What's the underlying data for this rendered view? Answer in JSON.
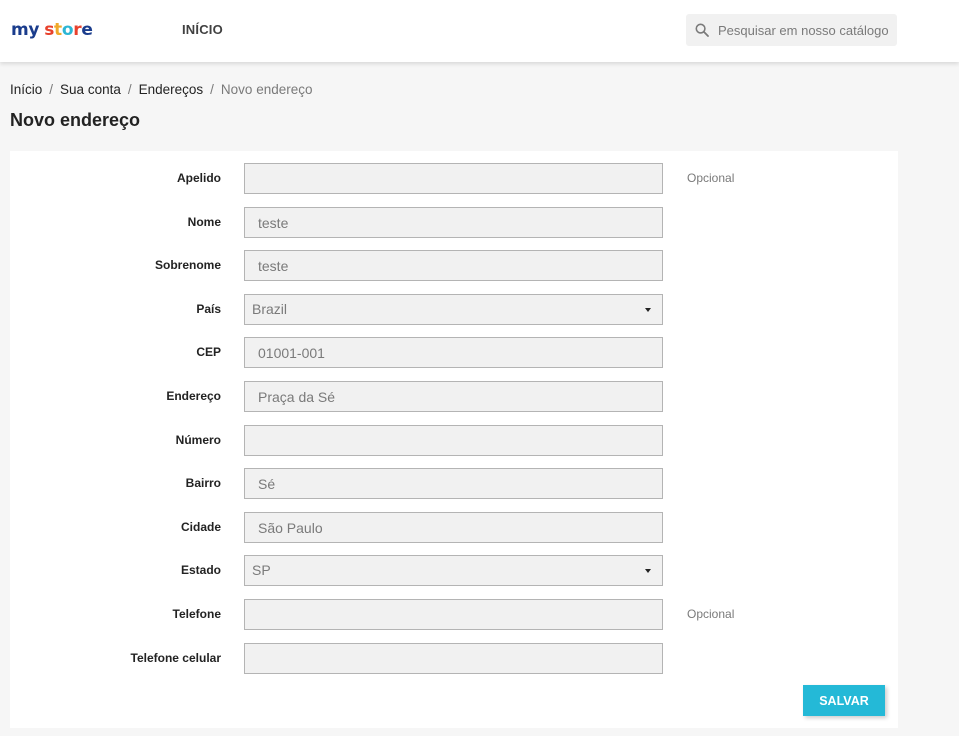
{
  "header": {
    "logo": {
      "parts": [
        {
          "text": "my",
          "color": "#1a3c8c"
        },
        {
          "text": " ",
          "color": "#1a3c8c"
        },
        {
          "text": "s",
          "color": "#e8412c"
        },
        {
          "text": "t",
          "color": "#f0a92a"
        },
        {
          "text": "o",
          "color": "#2cb6d4"
        },
        {
          "text": "r",
          "color": "#e8412c"
        },
        {
          "text": "e",
          "color": "#1a3c8c"
        }
      ]
    },
    "nav_home": "Início",
    "search_placeholder": "Pesquisar em nosso catálogo",
    "search_icon": "search-icon"
  },
  "breadcrumb": [
    "Início",
    "Sua conta",
    "Endereços",
    "Novo endereço"
  ],
  "page_title": "Novo endereço",
  "form": {
    "fields": [
      {
        "label": "Apelido",
        "value": "",
        "type": "text",
        "hint": "Opcional"
      },
      {
        "label": "Nome",
        "value": "teste",
        "type": "text"
      },
      {
        "label": "Sobrenome",
        "value": "teste",
        "type": "text"
      },
      {
        "label": "País",
        "value": "Brazil",
        "type": "select"
      },
      {
        "label": "CEP",
        "value": "01001-001",
        "type": "text"
      },
      {
        "label": "Endereço",
        "value": "Praça da Sé",
        "type": "text"
      },
      {
        "label": "Número",
        "value": "",
        "type": "text"
      },
      {
        "label": "Bairro",
        "value": "Sé",
        "type": "text"
      },
      {
        "label": "Cidade",
        "value": "São Paulo",
        "type": "text"
      },
      {
        "label": "Estado",
        "value": "SP",
        "type": "select"
      },
      {
        "label": "Telefone",
        "value": "",
        "type": "text",
        "hint": "Opcional"
      },
      {
        "label": "Telefone celular",
        "value": "",
        "type": "text"
      }
    ],
    "save_label": "Salvar"
  },
  "colors": {
    "accent": "#24b9d7",
    "field_bg": "#f1f1f1",
    "page_bg": "#f6f6f6"
  }
}
